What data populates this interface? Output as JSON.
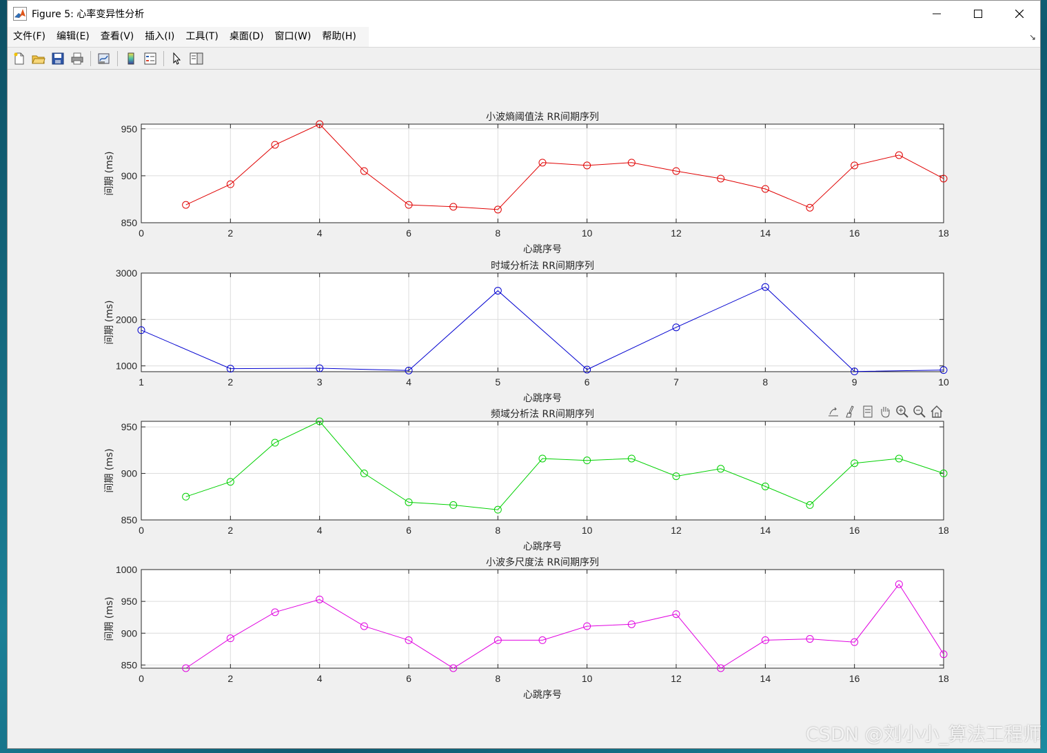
{
  "window": {
    "title": "Figure 5: 心率变异性分析"
  },
  "menu": {
    "items": [
      "文件(F)",
      "编辑(E)",
      "查看(V)",
      "插入(I)",
      "工具(T)",
      "桌面(D)",
      "窗口(W)",
      "帮助(H)"
    ]
  },
  "toolbar": {
    "icons": [
      "new-figure-icon",
      "open-file-icon",
      "save-icon",
      "print-icon",
      "link-plot-icon",
      "colorbar-icon",
      "legend-icon",
      "edit-plot-icon",
      "property-inspector-icon"
    ]
  },
  "axes_toolbar": {
    "icons": [
      "export-icon",
      "brush-icon",
      "data-tips-icon",
      "pan-icon",
      "zoom-in-icon",
      "zoom-out-icon",
      "restore-view-icon"
    ]
  },
  "watermark": "CSDN @刘小小_算法工程师",
  "chart_data": [
    {
      "type": "line",
      "title": "小波熵阈值法 RR间期序列",
      "xlabel": "心跳序号",
      "ylabel": "间期 (ms)",
      "color": "#e00000",
      "xlim": [
        0,
        18
      ],
      "ylim": [
        850,
        955
      ],
      "xticks": [
        0,
        2,
        4,
        6,
        8,
        10,
        12,
        14,
        16,
        18
      ],
      "yticks": [
        850,
        900,
        950
      ],
      "grid": true,
      "marker": "circle",
      "x": [
        1,
        2,
        3,
        4,
        5,
        6,
        7,
        8,
        9,
        10,
        11,
        12,
        13,
        14,
        15,
        16,
        17,
        18
      ],
      "y": [
        869,
        891,
        933,
        955,
        905,
        869,
        867,
        864,
        914,
        911,
        914,
        905,
        897,
        886,
        866,
        911,
        922,
        897
      ]
    },
    {
      "type": "line",
      "title": "时域分析法 RR间期序列",
      "xlabel": "心跳序号",
      "ylabel": "间期 (ms)",
      "color": "#0000d0",
      "xlim": [
        1,
        10
      ],
      "ylim": [
        875,
        3000
      ],
      "xticks": [
        1,
        2,
        3,
        4,
        5,
        6,
        7,
        8,
        9,
        10
      ],
      "yticks": [
        1000,
        2000,
        3000
      ],
      "grid": true,
      "marker": "circle",
      "x": [
        1,
        2,
        3,
        4,
        5,
        6,
        7,
        8,
        9,
        10
      ],
      "y": [
        1770,
        940,
        950,
        900,
        2620,
        920,
        1830,
        2700,
        880,
        910
      ]
    },
    {
      "type": "line",
      "title": "频域分析法 RR间期序列",
      "xlabel": "心跳序号",
      "ylabel": "间期 (ms)",
      "color": "#00d000",
      "xlim": [
        0,
        18
      ],
      "ylim": [
        850,
        956
      ],
      "xticks": [
        0,
        2,
        4,
        6,
        8,
        10,
        12,
        14,
        16,
        18
      ],
      "yticks": [
        850,
        900,
        950
      ],
      "grid": true,
      "marker": "circle",
      "x": [
        1,
        2,
        3,
        4,
        5,
        6,
        7,
        8,
        9,
        10,
        11,
        12,
        13,
        14,
        15,
        16,
        17,
        18
      ],
      "y": [
        875,
        891,
        933,
        956,
        900,
        869,
        866,
        861,
        916,
        914,
        916,
        897,
        905,
        886,
        866,
        911,
        916,
        900
      ]
    },
    {
      "type": "line",
      "title": "小波多尺度法 RR间期序列",
      "xlabel": "心跳序号",
      "ylabel": "间期 (ms)",
      "color": "#e000e0",
      "xlim": [
        0,
        18
      ],
      "ylim": [
        845,
        1000
      ],
      "xticks": [
        0,
        2,
        4,
        6,
        8,
        10,
        12,
        14,
        16,
        18
      ],
      "yticks": [
        850,
        900,
        950,
        1000
      ],
      "grid": true,
      "marker": "circle",
      "x": [
        1,
        2,
        3,
        4,
        5,
        6,
        7,
        8,
        9,
        10,
        11,
        12,
        13,
        14,
        15,
        16,
        17,
        18
      ],
      "y": [
        845,
        892,
        933,
        953,
        911,
        889,
        845,
        889,
        889,
        911,
        914,
        930,
        845,
        889,
        891,
        886,
        977,
        867
      ]
    }
  ]
}
